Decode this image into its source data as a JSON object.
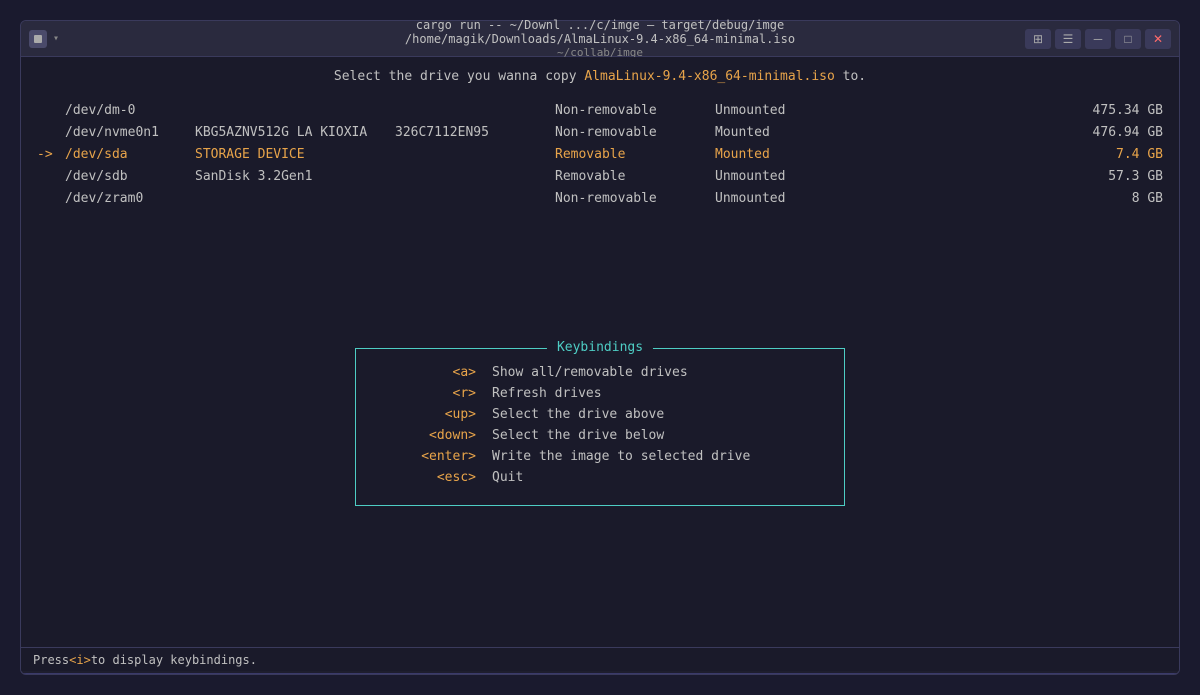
{
  "window": {
    "title": "cargo run -- ~/Downl .../c/imge — target/debug/imge /home/magik/Downloads/AlmaLinux-9.4-x86_64-minimal.iso",
    "subtitle": "~/collab/imge",
    "controls": [
      "grid-icon",
      "menu-icon",
      "minimize-icon",
      "maximize-icon",
      "close-icon"
    ]
  },
  "header": {
    "prefix": "Select the drive you wanna copy ",
    "iso": "AlmaLinux-9.4-x86_64-minimal.iso",
    "suffix": " to."
  },
  "drives": [
    {
      "arrow": "",
      "dev": "/dev/dm-0",
      "model": "",
      "serial": "",
      "removable": "Non-removable",
      "mounted": "Unmounted",
      "size": "475.34 GB",
      "selected": false
    },
    {
      "arrow": "",
      "dev": "/dev/nvme0n1",
      "model": "KBG5AZNV512G LA KIOXIA",
      "serial": "326C7112EN95",
      "removable": "Non-removable",
      "mounted": "Mounted",
      "size": "476.94 GB",
      "selected": false
    },
    {
      "arrow": "->",
      "dev": "/dev/sda",
      "model": "STORAGE DEVICE",
      "serial": "",
      "removable": "Removable",
      "mounted": "Mounted",
      "size": "7.4 GB",
      "selected": true
    },
    {
      "arrow": "",
      "dev": "/dev/sdb",
      "model": "SanDisk 3.2Gen1",
      "serial": "",
      "removable": "Removable",
      "mounted": "Unmounted",
      "size": "57.3 GB",
      "selected": false
    },
    {
      "arrow": "",
      "dev": "/dev/zram0",
      "model": "",
      "serial": "",
      "removable": "Non-removable",
      "mounted": "Unmounted",
      "size": "8 GB",
      "selected": false
    }
  ],
  "keybindings": {
    "title": "Keybindings",
    "items": [
      {
        "key": "<a>",
        "description": "Show all/removable drives"
      },
      {
        "key": "<r>",
        "description": "Refresh drives"
      },
      {
        "key": "<up>",
        "description": "Select the drive above"
      },
      {
        "key": "<down>",
        "description": "Select the drive below"
      },
      {
        "key": "<enter>",
        "description": "Write the image to selected drive"
      },
      {
        "key": "<esc>",
        "description": "Quit"
      }
    ]
  },
  "statusbar": {
    "prefix": "Press ",
    "key": "<i>",
    "suffix": " to display keybindings."
  }
}
